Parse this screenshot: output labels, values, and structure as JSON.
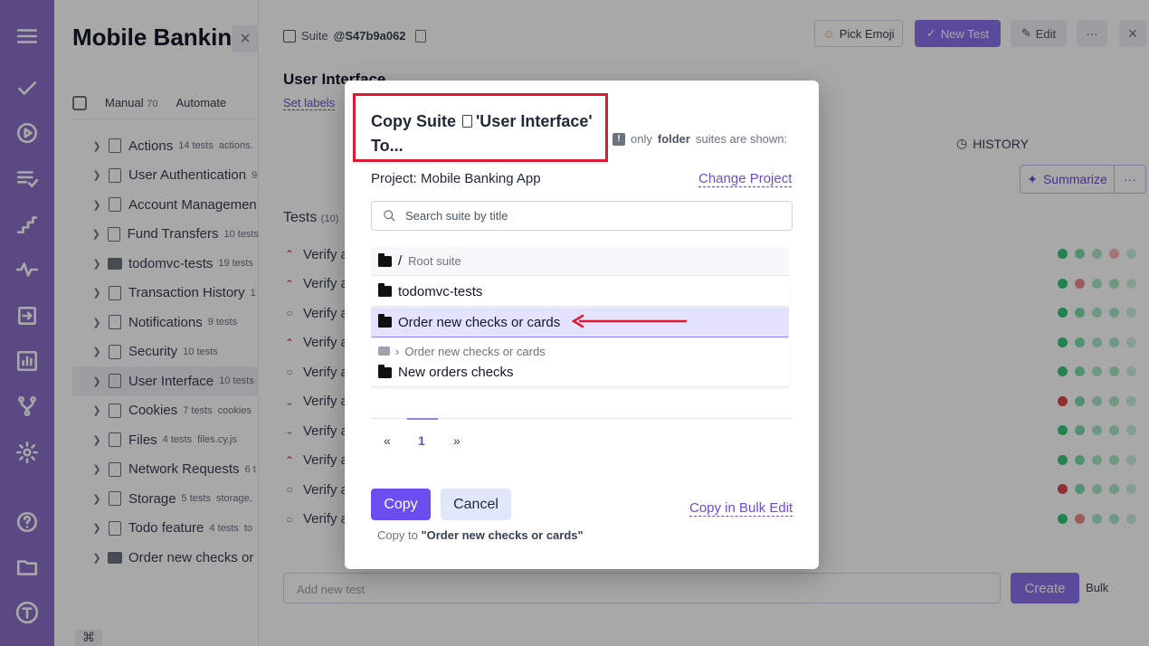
{
  "rail": {
    "icons": [
      "menu-icon",
      "check-icon",
      "play-icon",
      "list-check-icon",
      "steps-icon",
      "activity-icon",
      "import-icon",
      "analytics-icon",
      "branch-icon",
      "settings-icon",
      "help-icon",
      "folder-icon",
      "user-avatar-icon"
    ],
    "color": "#8b6fc9"
  },
  "sidebar": {
    "project_title": "Mobile Bankin",
    "close": "×",
    "tabs": [
      {
        "label": "Manual",
        "count": "70"
      },
      {
        "label": "Automate",
        "count": ""
      }
    ],
    "suites": [
      {
        "label": "Actions",
        "count": "14 tests",
        "extra": "actions.",
        "kind": "file"
      },
      {
        "label": "User Authentication",
        "count": "9",
        "extra": "",
        "kind": "file"
      },
      {
        "label": "Account Managemen",
        "count": "",
        "extra": "",
        "kind": "file"
      },
      {
        "label": "Fund Transfers",
        "count": "10 tests",
        "extra": "",
        "kind": "file"
      },
      {
        "label": "todomvc-tests",
        "count": "19 tests",
        "extra": "",
        "kind": "folder"
      },
      {
        "label": "Transaction History",
        "count": "1",
        "extra": "",
        "kind": "file"
      },
      {
        "label": "Notifications",
        "count": "9 tests",
        "extra": "",
        "kind": "file"
      },
      {
        "label": "Security",
        "count": "10 tests",
        "extra": "",
        "kind": "file"
      },
      {
        "label": "User Interface",
        "count": "10 tests",
        "extra": "",
        "kind": "file"
      },
      {
        "label": "Cookies",
        "count": "7 tests",
        "extra": "cookies",
        "kind": "file"
      },
      {
        "label": "Files",
        "count": "4 tests",
        "extra": "files.cy.js",
        "kind": "file"
      },
      {
        "label": "Network Requests",
        "count": "6 t",
        "extra": "",
        "kind": "file"
      },
      {
        "label": "Storage",
        "count": "5 tests",
        "extra": "storage.",
        "kind": "file"
      },
      {
        "label": "Todo feature",
        "count": "4 tests",
        "extra": "to",
        "kind": "file"
      },
      {
        "label": "Order new checks or",
        "count": "",
        "extra": "",
        "kind": "folder"
      }
    ]
  },
  "main": {
    "crumb_prefix": "Suite",
    "suite_id": "@S47b9a062",
    "pick_emoji": "Pick Emoji",
    "new_test": "New Test",
    "edit": "Edit",
    "more": "···",
    "close": "×",
    "title": "User Interface",
    "set_labels": "Set labels",
    "history": "HISTORY",
    "summarize": "Summarize",
    "tests_label": "Tests",
    "tests_count": "(10)",
    "tests": [
      "Verify a",
      "Verify a",
      "Verify a",
      "Verify a",
      "Verify a",
      "Verify a",
      "Verify a",
      "Verify a",
      "Verify a",
      "Verify a"
    ],
    "add_placeholder": "Add new test",
    "create": "Create",
    "bulk": "Bulk",
    "cmd": "⌘"
  },
  "modal": {
    "title_prefix": "Copy Suite",
    "title_suite": "'User Interface'",
    "title_suffix": "To...",
    "note_prefix": "only",
    "note_bold": "folder",
    "note_suffix": "suites are shown:",
    "project": "Project: Mobile Banking App",
    "change_project": "Change Project",
    "search_placeholder": "Search suite by title",
    "root_slash": "/",
    "root_label": "Root suite",
    "options": [
      "todomvc-tests",
      "Order new checks or cards"
    ],
    "nested_parent": "Order new checks or cards",
    "nested_child": "New orders checks",
    "pager": {
      "prev": "«",
      "page": "1",
      "next": "»"
    },
    "copy": "Copy",
    "cancel": "Cancel",
    "copy_bulk": "Copy in Bulk Edit",
    "copy_to_prefix": "Copy to",
    "copy_to_target": "\"Order new checks or cards\"",
    "highlight_color": "#e0172f",
    "accent": "#6c4ef0"
  }
}
